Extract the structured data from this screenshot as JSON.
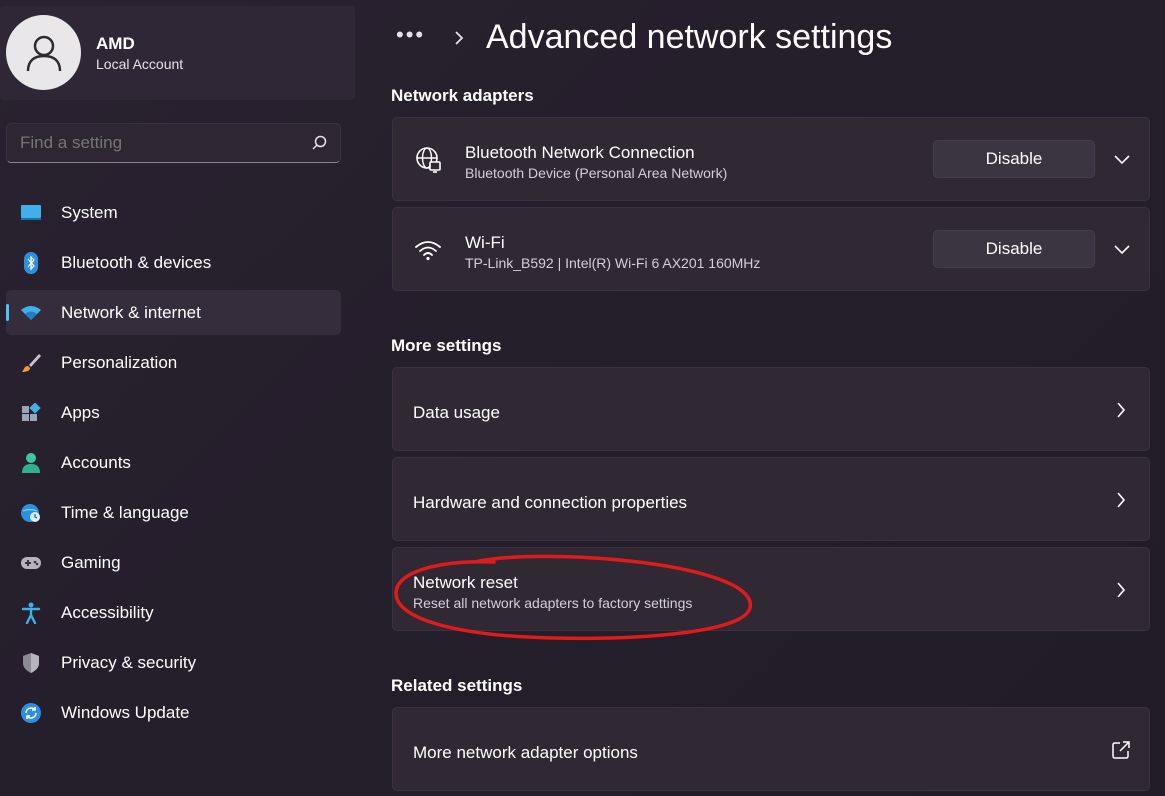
{
  "profile": {
    "name": "AMD",
    "account_type": "Local Account"
  },
  "search": {
    "placeholder": "Find a setting"
  },
  "sidebar": {
    "items": [
      {
        "label": "System",
        "icon": "system-icon"
      },
      {
        "label": "Bluetooth & devices",
        "icon": "bluetooth-icon"
      },
      {
        "label": "Network & internet",
        "icon": "wifi-icon",
        "active": true
      },
      {
        "label": "Personalization",
        "icon": "brush-icon"
      },
      {
        "label": "Apps",
        "icon": "apps-icon"
      },
      {
        "label": "Accounts",
        "icon": "person-icon"
      },
      {
        "label": "Time & language",
        "icon": "globe-clock-icon"
      },
      {
        "label": "Gaming",
        "icon": "gamepad-icon"
      },
      {
        "label": "Accessibility",
        "icon": "accessibility-icon"
      },
      {
        "label": "Privacy & security",
        "icon": "shield-icon"
      },
      {
        "label": "Windows Update",
        "icon": "update-icon"
      }
    ]
  },
  "header": {
    "breadcrumb_overflow": "•••",
    "title": "Advanced network settings"
  },
  "sections": {
    "adapters_title": "Network adapters",
    "more_title": "More settings",
    "related_title": "Related settings"
  },
  "adapters": [
    {
      "name": "Bluetooth Network Connection",
      "description": "Bluetooth Device (Personal Area Network)",
      "button": "Disable",
      "icon": "globe-network-icon"
    },
    {
      "name": "Wi-Fi",
      "description": "TP-Link_B592 | Intel(R) Wi-Fi 6 AX201 160MHz",
      "button": "Disable",
      "icon": "wifi-icon"
    }
  ],
  "more_settings": [
    {
      "label": "Data usage"
    },
    {
      "label": "Hardware and connection properties"
    },
    {
      "label": "Network reset",
      "description": "Reset all network adapters to factory settings"
    }
  ],
  "related_settings": [
    {
      "label": "More network adapter options",
      "icon": "external-link-icon"
    }
  ],
  "colors": {
    "accent": "#4cc2ff",
    "annotation": "#e01b1b",
    "background": "#241d29",
    "card": "#302833"
  }
}
